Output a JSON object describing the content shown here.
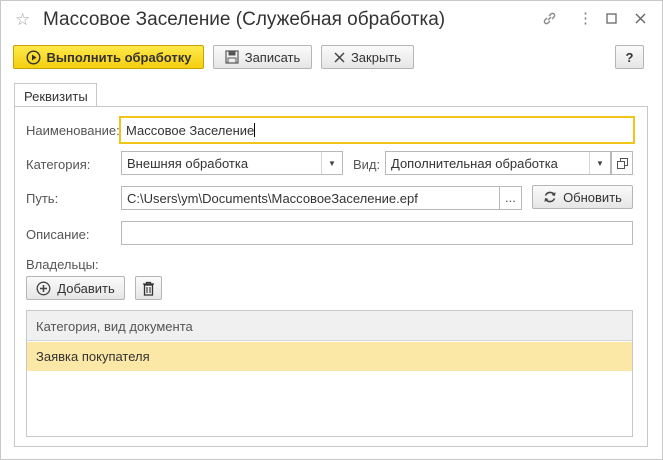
{
  "window": {
    "title": "Массовое Заселение (Служебная обработка)"
  },
  "toolbar": {
    "run_label": "Выполнить обработку",
    "save_label": "Записать",
    "close_label": "Закрыть",
    "help_label": "?"
  },
  "tabs": [
    {
      "label": "Реквизиты"
    }
  ],
  "form": {
    "name_label": "Наименование:",
    "name_value": "Массовое Заселение",
    "category_label": "Категория:",
    "category_value": "Внешняя обработка",
    "kind_label": "Вид:",
    "kind_value": "Дополнительная обработка",
    "path_label": "Путь:",
    "path_value": "C:\\Users\\ym\\Documents\\МассовоеЗаселение.epf",
    "path_browse": "...",
    "refresh_label": "Обновить",
    "description_label": "Описание:",
    "description_value": "",
    "owners_label": "Владельцы:",
    "add_label": "Добавить"
  },
  "owners_table": {
    "columns": [
      "Категория, вид документа"
    ],
    "rows": [
      {
        "value": "Заявка покупателя",
        "selected": true
      }
    ]
  },
  "colors": {
    "accent": "#f5cf10",
    "selected_row": "#fbe7a6",
    "focus_border": "#f0c419"
  },
  "icons": [
    "star-icon",
    "link-icon",
    "more-icon",
    "maximize-icon",
    "close-icon",
    "play-icon",
    "save-icon",
    "refresh-icon",
    "add-icon",
    "trash-icon",
    "dropdown-icon",
    "open-icon"
  ]
}
